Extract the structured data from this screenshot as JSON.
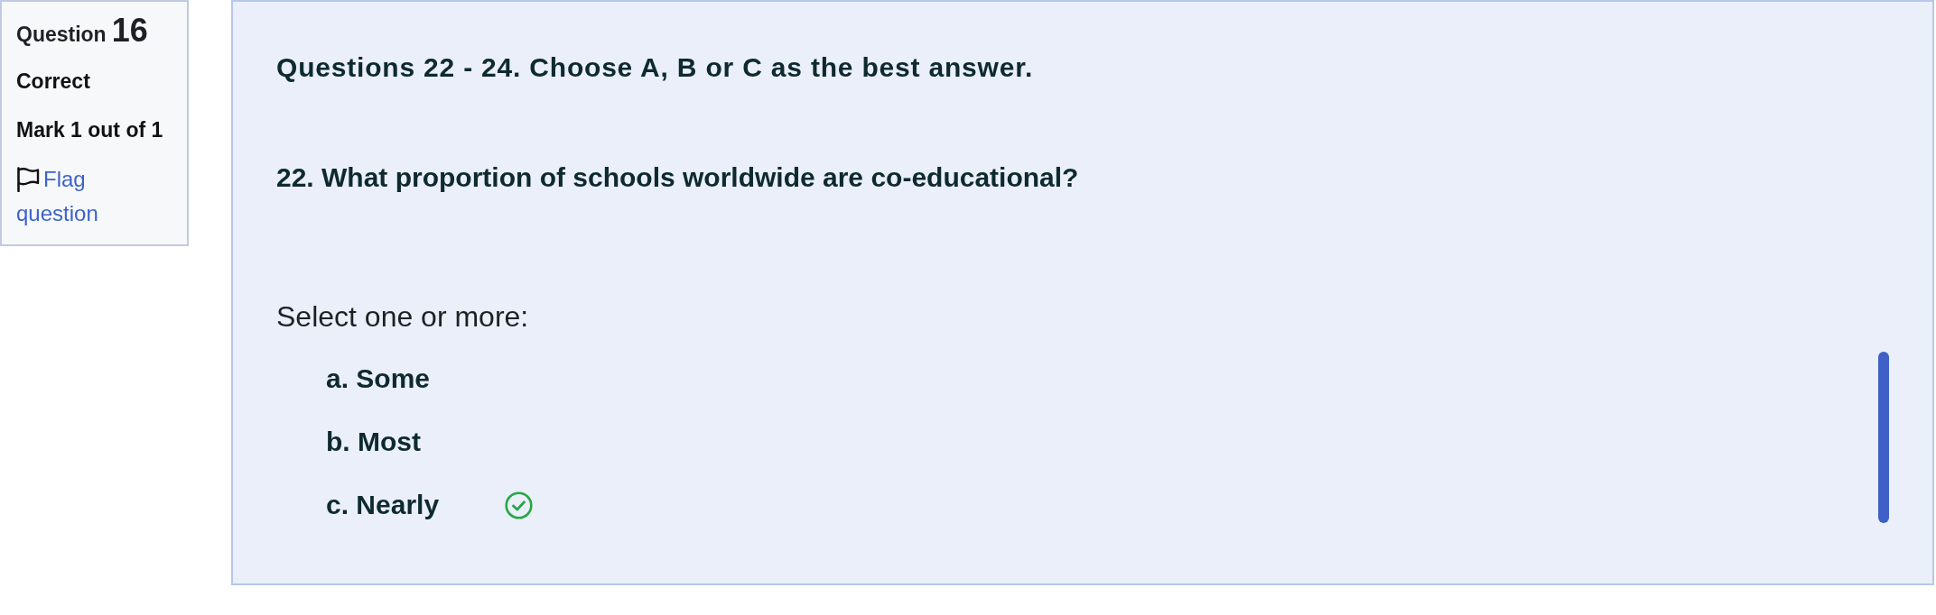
{
  "question_info": {
    "label": "Question",
    "number": "16",
    "status": "Correct",
    "mark": "Mark 1 out of 1",
    "flag_link": "Flag question"
  },
  "question": {
    "instructions": "Questions 22 - 24. Choose A, B or C as the best answer.",
    "prompt": "22. What proportion of schools worldwide are co-educational?",
    "answer_hint": "Select one or more:",
    "options": [
      {
        "label": "a. Some",
        "correct": false
      },
      {
        "label": "b. Most",
        "correct": false
      },
      {
        "label": "c. Nearly",
        "correct": true
      }
    ]
  }
}
